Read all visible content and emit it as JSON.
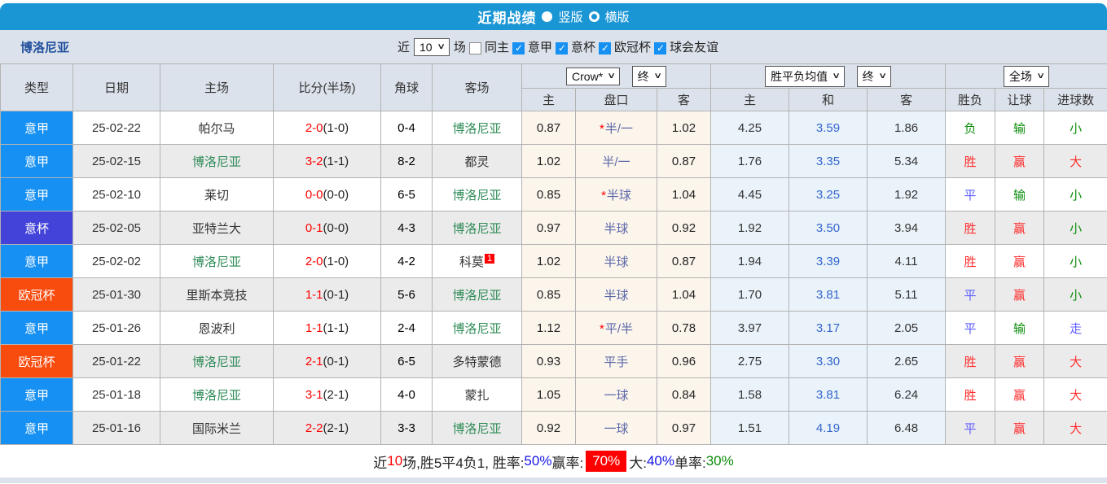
{
  "colors": {
    "topbar_bg": "#1b96d5",
    "panel_bg": "#dce2eb",
    "serie_a_badge": "#1690f2",
    "coppa_italia_badge": "#4343d9",
    "ucl_badge": "#f84b0e",
    "bologna_green": "#2e8b57",
    "win_red": "#ff2d2d",
    "draw_blue": "#5c5cff",
    "lose_green": "#0b8c0b"
  },
  "topbar": {
    "title": "近期战绩",
    "vertical_label": "竖版",
    "horizontal_label": "横版"
  },
  "filterbar": {
    "team": "博洛尼亚",
    "near_label": "近",
    "count_value": "10",
    "games_label": "场",
    "same_home_label": "同主",
    "leagues": [
      "意甲",
      "意杯",
      "欧冠杯",
      "球会友谊"
    ]
  },
  "table": {
    "headers": [
      "类型",
      "日期",
      "主场",
      "比分(半场)",
      "角球",
      "客场"
    ],
    "controls": {
      "odds_source": "Crow*",
      "odds_time": "终",
      "mean_source": "胜平负均值",
      "mean_time": "终",
      "scope": "全场"
    },
    "sub_headers": [
      "主",
      "盘口",
      "客",
      "主",
      "和",
      "客",
      "胜负",
      "让球",
      "进球数"
    ],
    "rows": [
      {
        "league": "意甲",
        "league_bg": "#1690f2",
        "date": "25-02-22",
        "home": "帕尔马",
        "home_green": false,
        "score": "2-0",
        "half": "(1-0)",
        "corner": "0-4",
        "away": "博洛尼亚",
        "away_green": true,
        "away_badge": "",
        "odds_home": "0.87",
        "star": true,
        "handicap": "半/一",
        "odds_away": "1.02",
        "mean_home": "4.25",
        "mean_draw": "3.59",
        "mean_away": "1.86",
        "result": "负",
        "result_c": "green",
        "let": "输",
        "let_c": "green",
        "goal": "小",
        "goal_c": "green"
      },
      {
        "league": "意甲",
        "league_bg": "#1690f2",
        "date": "25-02-15",
        "home": "博洛尼亚",
        "home_green": true,
        "score": "3-2",
        "half": "(1-1)",
        "corner": "8-2",
        "away": "都灵",
        "away_green": false,
        "away_badge": "",
        "odds_home": "1.02",
        "star": false,
        "handicap": "半/一",
        "odds_away": "0.87",
        "mean_home": "1.76",
        "mean_draw": "3.35",
        "mean_away": "5.34",
        "result": "胜",
        "result_c": "red",
        "let": "赢",
        "let_c": "red",
        "goal": "大",
        "goal_c": "red"
      },
      {
        "league": "意甲",
        "league_bg": "#1690f2",
        "date": "25-02-10",
        "home": "莱切",
        "home_green": false,
        "score": "0-0",
        "half": "(0-0)",
        "corner": "6-5",
        "away": "博洛尼亚",
        "away_green": true,
        "away_badge": "",
        "odds_home": "0.85",
        "star": true,
        "handicap": "半球",
        "odds_away": "1.04",
        "mean_home": "4.45",
        "mean_draw": "3.25",
        "mean_away": "1.92",
        "result": "平",
        "result_c": "blue",
        "let": "输",
        "let_c": "green",
        "goal": "小",
        "goal_c": "green"
      },
      {
        "league": "意杯",
        "league_bg": "#4343d9",
        "date": "25-02-05",
        "home": "亚特兰大",
        "home_green": false,
        "score": "0-1",
        "half": "(0-0)",
        "corner": "4-3",
        "away": "博洛尼亚",
        "away_green": true,
        "away_badge": "",
        "odds_home": "0.97",
        "star": false,
        "handicap": "半球",
        "odds_away": "0.92",
        "mean_home": "1.92",
        "mean_draw": "3.50",
        "mean_away": "3.94",
        "result": "胜",
        "result_c": "red",
        "let": "赢",
        "let_c": "red",
        "goal": "小",
        "goal_c": "green"
      },
      {
        "league": "意甲",
        "league_bg": "#1690f2",
        "date": "25-02-02",
        "home": "博洛尼亚",
        "home_green": true,
        "score": "2-0",
        "half": "(1-0)",
        "corner": "4-2",
        "away": "科莫",
        "away_green": false,
        "away_badge": "1",
        "odds_home": "1.02",
        "star": false,
        "handicap": "半球",
        "odds_away": "0.87",
        "mean_home": "1.94",
        "mean_draw": "3.39",
        "mean_away": "4.11",
        "result": "胜",
        "result_c": "red",
        "let": "赢",
        "let_c": "red",
        "goal": "小",
        "goal_c": "green"
      },
      {
        "league": "欧冠杯",
        "league_bg": "#f84b0e",
        "date": "25-01-30",
        "home": "里斯本竞技",
        "home_green": false,
        "score": "1-1",
        "half": "(0-1)",
        "corner": "5-6",
        "away": "博洛尼亚",
        "away_green": true,
        "away_badge": "",
        "odds_home": "0.85",
        "star": false,
        "handicap": "半球",
        "odds_away": "1.04",
        "mean_home": "1.70",
        "mean_draw": "3.81",
        "mean_away": "5.11",
        "result": "平",
        "result_c": "blue",
        "let": "赢",
        "let_c": "red",
        "goal": "小",
        "goal_c": "green"
      },
      {
        "league": "意甲",
        "league_bg": "#1690f2",
        "date": "25-01-26",
        "home": "恩波利",
        "home_green": false,
        "score": "1-1",
        "half": "(1-1)",
        "corner": "2-4",
        "away": "博洛尼亚",
        "away_green": true,
        "away_badge": "",
        "odds_home": "1.12",
        "star": true,
        "handicap": "平/半",
        "odds_away": "0.78",
        "mean_home": "3.97",
        "mean_draw": "3.17",
        "mean_away": "2.05",
        "result": "平",
        "result_c": "blue",
        "let": "输",
        "let_c": "green",
        "goal": "走",
        "goal_c": "blue"
      },
      {
        "league": "欧冠杯",
        "league_bg": "#f84b0e",
        "date": "25-01-22",
        "home": "博洛尼亚",
        "home_green": true,
        "score": "2-1",
        "half": "(0-1)",
        "corner": "6-5",
        "away": "多特蒙德",
        "away_green": false,
        "away_badge": "",
        "odds_home": "0.93",
        "star": false,
        "handicap": "平手",
        "odds_away": "0.96",
        "mean_home": "2.75",
        "mean_draw": "3.30",
        "mean_away": "2.65",
        "result": "胜",
        "result_c": "red",
        "let": "赢",
        "let_c": "red",
        "goal": "大",
        "goal_c": "red"
      },
      {
        "league": "意甲",
        "league_bg": "#1690f2",
        "date": "25-01-18",
        "home": "博洛尼亚",
        "home_green": true,
        "score": "3-1",
        "half": "(2-1)",
        "corner": "4-0",
        "away": "蒙扎",
        "away_green": false,
        "away_badge": "",
        "odds_home": "1.05",
        "star": false,
        "handicap": "一球",
        "odds_away": "0.84",
        "mean_home": "1.58",
        "mean_draw": "3.81",
        "mean_away": "6.24",
        "result": "胜",
        "result_c": "red",
        "let": "赢",
        "let_c": "red",
        "goal": "大",
        "goal_c": "red"
      },
      {
        "league": "意甲",
        "league_bg": "#1690f2",
        "date": "25-01-16",
        "home": "国际米兰",
        "home_green": false,
        "score": "2-2",
        "half": "(2-1)",
        "corner": "3-3",
        "away": "博洛尼亚",
        "away_green": true,
        "away_badge": "",
        "odds_home": "0.92",
        "star": false,
        "handicap": "一球",
        "odds_away": "0.97",
        "mean_home": "1.51",
        "mean_draw": "4.19",
        "mean_away": "6.48",
        "result": "平",
        "result_c": "blue",
        "let": "赢",
        "let_c": "red",
        "goal": "大",
        "goal_c": "red"
      }
    ]
  },
  "footer": {
    "parts": [
      {
        "t": "近",
        "c": "plain"
      },
      {
        "t": "10",
        "c": "red"
      },
      {
        "t": "场,胜5平4负1, 胜率:",
        "c": "plain"
      },
      {
        "t": "50%",
        "c": "blue"
      },
      {
        "t": " 赢率: ",
        "c": "plain"
      },
      {
        "t": "70%",
        "c": "chip"
      },
      {
        "t": " 大:",
        "c": "plain"
      },
      {
        "t": "40%",
        "c": "blue"
      },
      {
        "t": " 单率:",
        "c": "plain"
      },
      {
        "t": "30%",
        "c": "green"
      }
    ]
  }
}
